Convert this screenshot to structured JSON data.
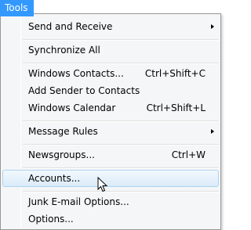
{
  "menubar": {
    "tools_label": "Tools"
  },
  "menu": {
    "send_receive": {
      "label": "Send and Receive"
    },
    "synchronize_all": {
      "label": "Synchronize All"
    },
    "windows_contacts": {
      "label": "Windows Contacts...",
      "shortcut": "Ctrl+Shift+C"
    },
    "add_sender": {
      "label": "Add Sender to Contacts"
    },
    "windows_calendar": {
      "label": "Windows Calendar",
      "shortcut": "Ctrl+Shift+L"
    },
    "message_rules": {
      "label": "Message Rules"
    },
    "newsgroups": {
      "label": "Newsgroups...",
      "shortcut": "Ctrl+W"
    },
    "accounts": {
      "label": "Accounts..."
    },
    "junk_email": {
      "label": "Junk E-mail Options..."
    },
    "options": {
      "label": "Options..."
    }
  },
  "colors": {
    "menubar_highlight": "#3399ff",
    "menu_background": "#f5f6f7",
    "hover_border": "#aed3f2"
  },
  "icons": {
    "submenu_arrow": "chevron-right-icon",
    "cursor": "mouse-pointer-icon"
  }
}
